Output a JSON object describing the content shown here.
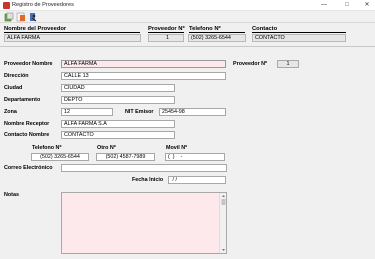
{
  "window": {
    "title": "Registro de Proveedores",
    "minimize": "—",
    "maximize": "□",
    "close": "✕"
  },
  "toolbar": {
    "icons": [
      "add-record-icon",
      "edit-record-icon",
      "exit-icon"
    ]
  },
  "grid": {
    "headers": {
      "nombre": "Nombre del Proveedor",
      "proveedor_no": "Proveedor Nº",
      "telefono_no": "Telefono Nº",
      "contacto": "Contacto"
    },
    "row": {
      "nombre": "ALFA FARMA",
      "proveedor_no": "1",
      "telefono_no": "(502) 3265-6544",
      "contacto": "CONTACTO"
    }
  },
  "form": {
    "proveedor_nombre": {
      "label": "Proveedor Nombre",
      "value": "ALFA FARMA"
    },
    "proveedor_no": {
      "label": "Proveedor  Nº",
      "value": "1"
    },
    "direccion": {
      "label": "Dirección",
      "value": "CALLE 13"
    },
    "ciudad": {
      "label": "Ciudad",
      "value": "CIUDAD"
    },
    "departamento": {
      "label": "Departamento",
      "value": "DEPTO"
    },
    "zona": {
      "label": "Zona",
      "value": "12"
    },
    "nit_emisor": {
      "label": "NIT Emisor",
      "value": "25454-98"
    },
    "nombre_receptor": {
      "label": "Nombre Receptor",
      "value": "ALFA FARMA S.A"
    },
    "contacto_nombre": {
      "label": "Contacto Nombre",
      "value": "CONTACTO"
    },
    "telefono": {
      "label": "Telefono Nº",
      "value": "(502) 3265-6544"
    },
    "otro": {
      "label": "Otro Nº",
      "value": "(502) 4587-7989"
    },
    "movil": {
      "label": "Movil Nº",
      "value": "(  )    -"
    },
    "correo": {
      "label": "Correo Electrónico",
      "value": ""
    },
    "fecha_inicio": {
      "label": "Fecha Inicio",
      "value": " / /"
    },
    "notas": {
      "label": "Notas",
      "value": ""
    }
  },
  "colors": {
    "pink_field": "#fde9ec",
    "grey_field": "#e6e6e6"
  }
}
